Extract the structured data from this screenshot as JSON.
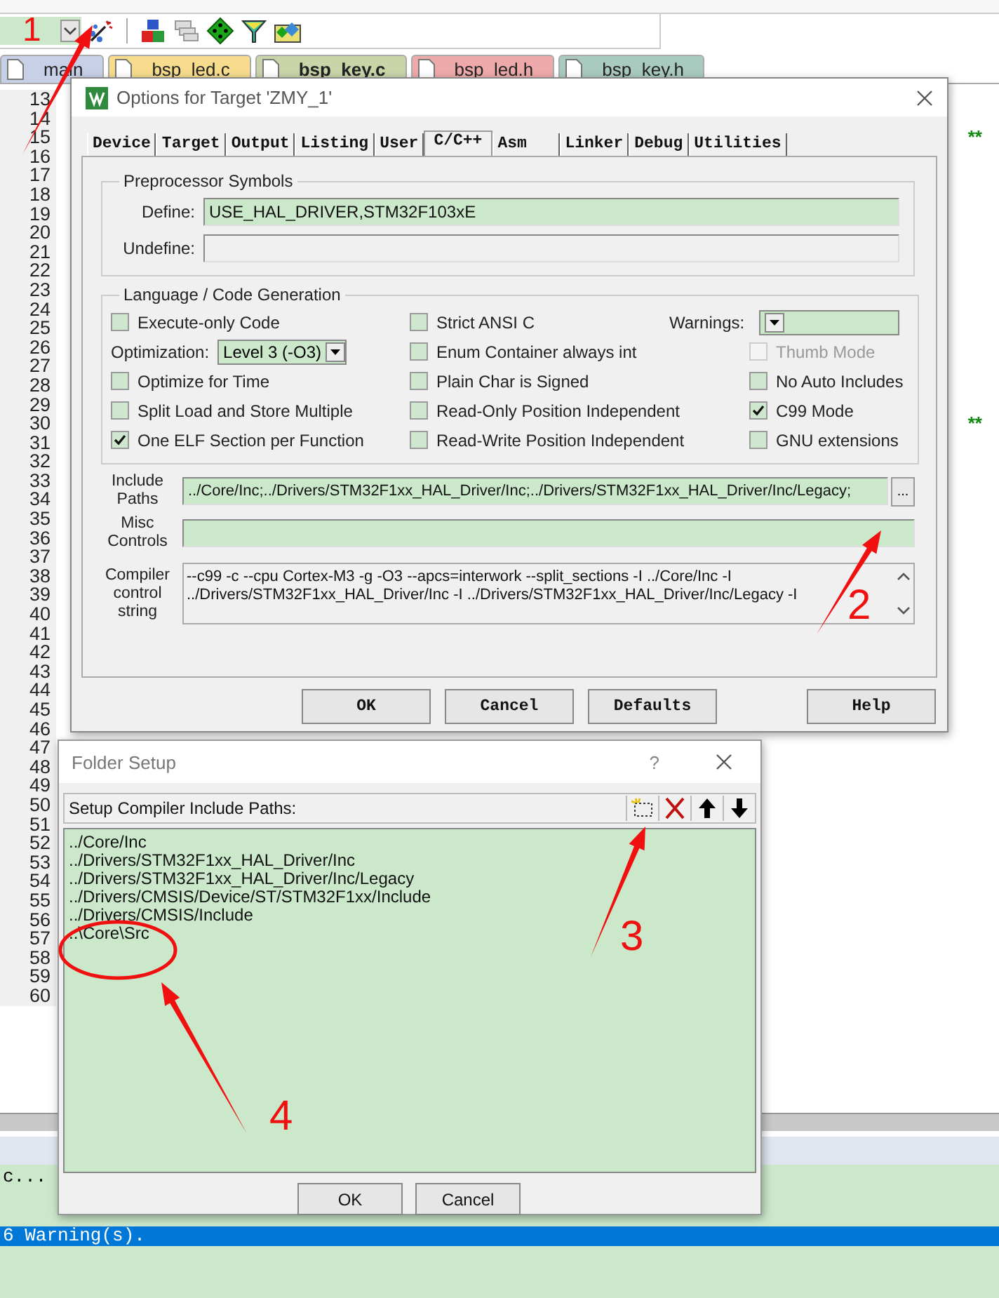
{
  "file_tabs": [
    {
      "label": "main",
      "color": "#c8d0e8",
      "selected": false
    },
    {
      "label": "bsp_led.c",
      "color": "#f6dc8c",
      "selected": false
    },
    {
      "label": "bsp_key.c",
      "color": "#c9d4a9",
      "selected": true
    },
    {
      "label": "bsp_led.h",
      "color": "#eeaaaa",
      "selected": false
    },
    {
      "label": "bsp_key.h",
      "color": "#a9cabf",
      "selected": false
    }
  ],
  "editor": {
    "lines": [
      {
        "number": "13"
      },
      {
        "number": "14"
      },
      {
        "number": "15",
        "code": "**"
      },
      {
        "number": "16"
      },
      {
        "number": "17"
      },
      {
        "number": "18"
      },
      {
        "number": "19"
      },
      {
        "number": "20"
      },
      {
        "number": "21"
      },
      {
        "number": "22"
      },
      {
        "number": "23"
      },
      {
        "number": "24"
      },
      {
        "number": "25"
      },
      {
        "number": "26"
      },
      {
        "number": "27"
      },
      {
        "number": "28"
      },
      {
        "number": "29"
      },
      {
        "number": "30",
        "code": "**"
      },
      {
        "number": "31"
      },
      {
        "number": "32"
      },
      {
        "number": "33"
      },
      {
        "number": "34"
      },
      {
        "number": "35"
      },
      {
        "number": "36"
      },
      {
        "number": "37"
      },
      {
        "number": "38"
      },
      {
        "number": "39"
      },
      {
        "number": "40"
      },
      {
        "number": "41"
      },
      {
        "number": "42"
      },
      {
        "number": "43"
      },
      {
        "number": "44"
      },
      {
        "number": "45"
      },
      {
        "number": "46"
      },
      {
        "number": "47"
      },
      {
        "number": "48"
      },
      {
        "number": "49"
      },
      {
        "number": "50"
      },
      {
        "number": "51"
      },
      {
        "number": "52"
      },
      {
        "number": "53"
      },
      {
        "number": "54"
      },
      {
        "number": "55"
      },
      {
        "number": "56"
      },
      {
        "number": "57"
      },
      {
        "number": "58"
      },
      {
        "number": "59"
      },
      {
        "number": "60"
      }
    ]
  },
  "output": {
    "lines": [
      {
        "text": "c...",
        "selected": false
      },
      {
        "text": "6 Warning(s).",
        "selected": true
      }
    ]
  },
  "options_dialog": {
    "title": "Options for Target 'ZMY_1'",
    "tabs": [
      {
        "label": "Device",
        "selected": false
      },
      {
        "label": "Target",
        "selected": false
      },
      {
        "label": "Output",
        "selected": false
      },
      {
        "label": "Listing",
        "selected": false
      },
      {
        "label": "User",
        "selected": false
      },
      {
        "label": "C/C++",
        "selected": true
      },
      {
        "label": "Asm",
        "selected": false
      },
      {
        "label": "Linker",
        "selected": false
      },
      {
        "label": "Debug",
        "selected": false
      },
      {
        "label": "Utilities",
        "selected": false
      }
    ],
    "preprocessor": {
      "title": "Preprocessor Symbols",
      "define": {
        "label": "Define:",
        "value": "USE_HAL_DRIVER,STM32F103xE"
      },
      "undefine": {
        "label": "Undefine:"
      }
    },
    "code_generation": {
      "title": "Language / Code Generation",
      "columns": [
        {
          "items": [
            {
              "kind": "checkbox",
              "label": "Execute-only Code",
              "checked": false,
              "disabled": false
            },
            {
              "kind": "combo",
              "label": "Optimization:",
              "value": "Level 3 (-O3)"
            },
            {
              "kind": "checkbox",
              "label": "Optimize for Time",
              "checked": false,
              "disabled": false
            },
            {
              "kind": "checkbox",
              "label": "Split Load and Store Multiple",
              "checked": false,
              "disabled": false
            },
            {
              "kind": "checkbox",
              "label": "One ELF Section per Function",
              "checked": true,
              "disabled": false
            }
          ]
        },
        {
          "items": [
            {
              "kind": "checkbox",
              "label": "Strict ANSI C",
              "checked": false,
              "disabled": false
            },
            {
              "kind": "checkbox",
              "label": "Enum Container always int",
              "checked": false,
              "disabled": false
            },
            {
              "kind": "checkbox",
              "label": "Plain Char is Signed",
              "checked": false,
              "disabled": false
            },
            {
              "kind": "checkbox",
              "label": "Read-Only Position Independent",
              "checked": false,
              "disabled": false
            },
            {
              "kind": "checkbox",
              "label": "Read-Write Position Independent",
              "checked": false,
              "disabled": false
            }
          ]
        },
        {
          "items": [
            {
              "kind": "combo",
              "label": "Warnings:"
            },
            {
              "kind": "checkbox",
              "label": "Thumb Mode",
              "checked": false,
              "disabled": true
            },
            {
              "kind": "checkbox",
              "label": "No Auto Includes",
              "checked": false,
              "disabled": false
            },
            {
              "kind": "checkbox",
              "label": "C99 Mode",
              "checked": true,
              "disabled": false
            },
            {
              "kind": "checkbox",
              "label": "GNU extensions",
              "checked": false,
              "disabled": false
            }
          ]
        }
      ]
    },
    "include_paths": {
      "label": "Include Paths",
      "value": "../Core/Inc;../Drivers/STM32F1xx_HAL_Driver/Inc;../Drivers/STM32F1xx_HAL_Driver/Inc/Legacy;",
      "browse_button": "..."
    },
    "misc_controls": {
      "label": "Misc Controls"
    },
    "compiler_string": {
      "label": "Compiler control string",
      "lines": [
        "--c99 -c --cpu Cortex-M3 -g -O3 --apcs=interwork --split_sections -I ../Core/Inc -I",
        "../Drivers/STM32F1xx_HAL_Driver/Inc -I ../Drivers/STM32F1xx_HAL_Driver/Inc/Legacy -I"
      ]
    },
    "buttons": [
      "OK",
      "Cancel",
      "Defaults",
      "Help"
    ]
  },
  "folder_dialog": {
    "title": "Folder Setup",
    "help": "?",
    "header": "Setup Compiler Include Paths:",
    "paths": [
      "../Core/Inc",
      "../Drivers/STM32F1xx_HAL_Driver/Inc",
      "../Drivers/STM32F1xx_HAL_Driver/Inc/Legacy",
      "../Drivers/CMSIS/Device/ST/STM32F1xx/Include",
      "../Drivers/CMSIS/Include",
      "..\\Core\\Src"
    ],
    "buttons": [
      "OK",
      "Cancel"
    ]
  },
  "annotations": [
    {
      "label": "1"
    },
    {
      "label": "2"
    },
    {
      "label": "3"
    },
    {
      "label": "4",
      "circle": true
    }
  ]
}
